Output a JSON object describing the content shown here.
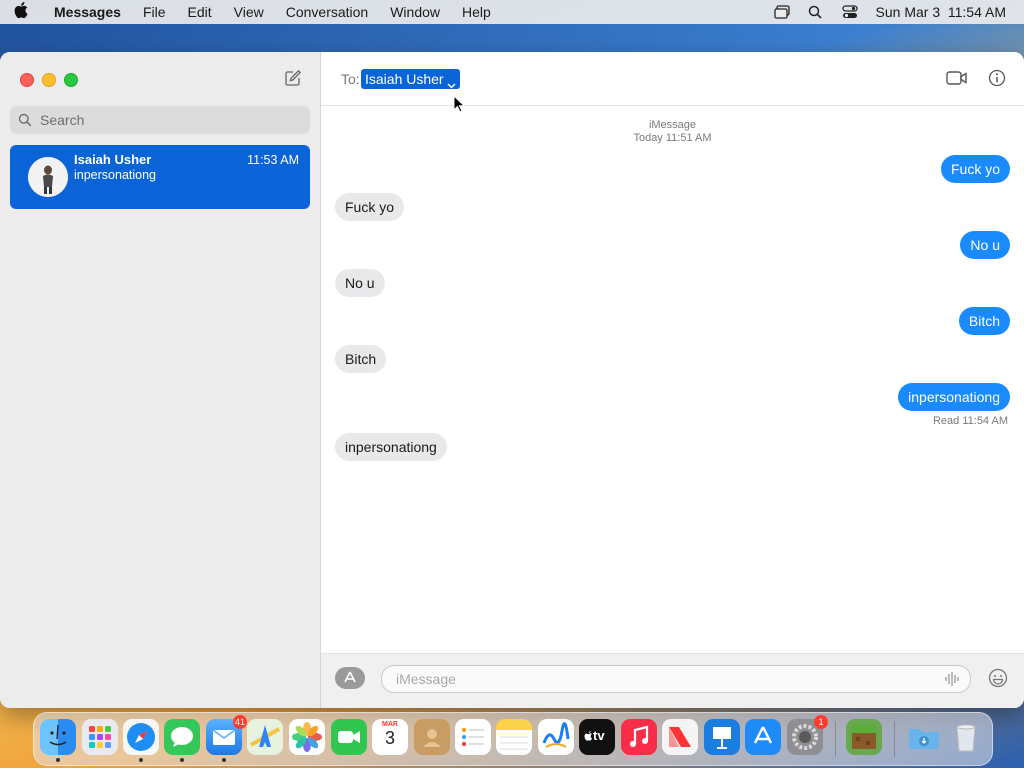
{
  "menubar": {
    "app_name": "Messages",
    "menus": [
      "File",
      "Edit",
      "View",
      "Conversation",
      "Window",
      "Help"
    ],
    "clock": "Sun Mar 3  11:54 AM"
  },
  "sidebar": {
    "search_placeholder": "Search",
    "conversations": [
      {
        "name": "Isaiah Usher",
        "preview": "inpersonationg",
        "time": "11:53 AM"
      }
    ]
  },
  "header": {
    "to_label": "To:",
    "recipient": "Isaiah Usher"
  },
  "thread": {
    "service": "iMessage",
    "timestamp": "Today 11:51 AM",
    "messages": [
      {
        "from": "me",
        "text": "Fuck yo"
      },
      {
        "from": "them",
        "text": "Fuck yo"
      },
      {
        "from": "me",
        "text": "No u"
      },
      {
        "from": "them",
        "text": "No u"
      },
      {
        "from": "me",
        "text": "Bitch"
      },
      {
        "from": "them",
        "text": "Bitch"
      },
      {
        "from": "me",
        "text": "inpersonationg"
      },
      {
        "from": "them",
        "text": "inpersonationg"
      }
    ],
    "read_receipt": "Read 11:54 AM"
  },
  "composer": {
    "placeholder": "iMessage"
  },
  "dock": {
    "calendar_month": "MAR",
    "calendar_day": "3",
    "mail_badge": "41",
    "settings_badge": "1",
    "tv_label": "tv",
    "colors": {
      "finder": "#2a8cf0",
      "messages": "#34c759",
      "facetime": "#30c64f",
      "music": "#fa2d48",
      "news": "#f5f5f5",
      "appstore": "#1d8cf8",
      "keynote": "#1a7de0"
    }
  },
  "colors": {
    "accent": "#0a64d8",
    "outgoing_bubble": "#1a8bff",
    "incoming_bubble": "#e9e9eb"
  }
}
